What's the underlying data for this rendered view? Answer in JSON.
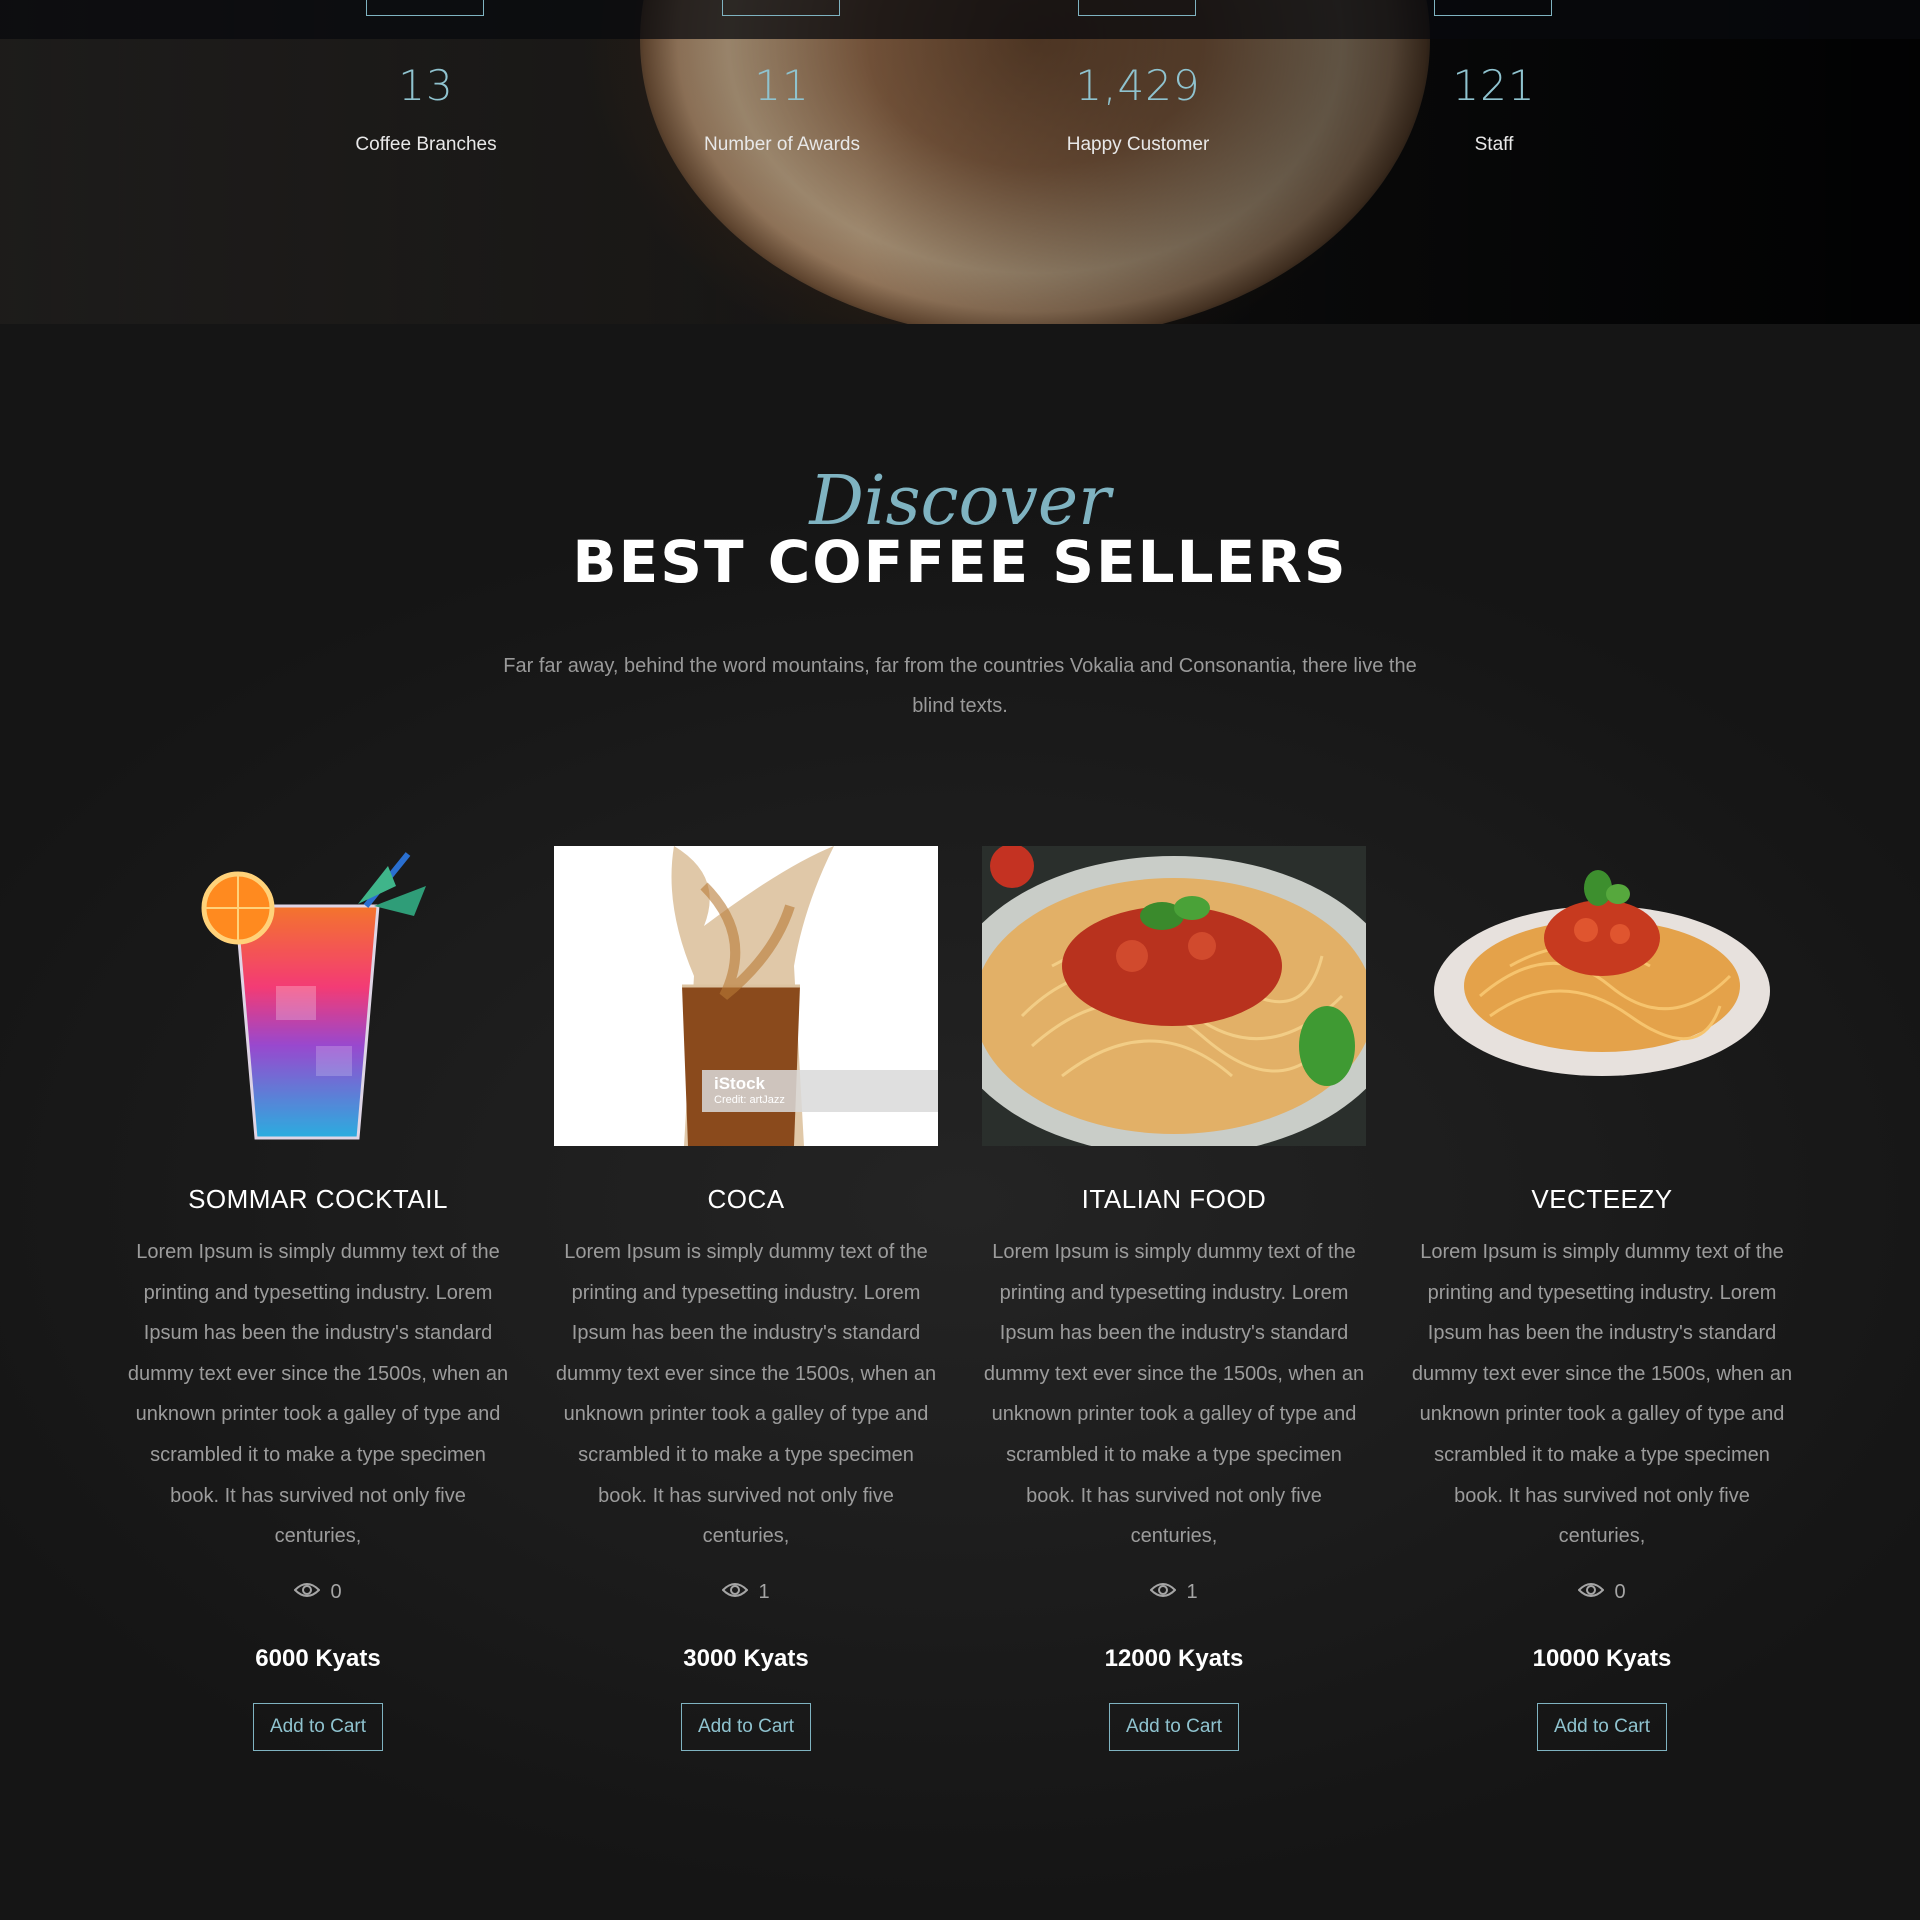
{
  "stats": [
    {
      "value": "13",
      "label": "Coffee Branches"
    },
    {
      "value": "11",
      "label": "Number of Awards"
    },
    {
      "value": "1,429",
      "label": "Happy Customer"
    },
    {
      "value": "121",
      "label": "Staff"
    }
  ],
  "section": {
    "script_title": "Discover",
    "title": "BEST COFFEE SELLERS",
    "subtitle": "Far far away, behind the word mountains, far from the countries Vokalia and Consonantia, there live the blind texts."
  },
  "products": [
    {
      "name": "SOMMAR COCKTAIL",
      "description": "Lorem Ipsum is simply dummy text of the printing and typesetting industry. Lorem Ipsum has been the industry's standard dummy text ever since the 1500s, when an unknown printer took a galley of type and scrambled it to make a type specimen book. It has survived not only five centuries,",
      "views": "0",
      "price": "6000 Kyats",
      "cart_label": "Add to Cart",
      "image_icon": "cocktail-glass-image"
    },
    {
      "name": "COCA",
      "description": "Lorem Ipsum is simply dummy text of the printing and typesetting industry. Lorem Ipsum has been the industry's standard dummy text ever since the 1500s, when an unknown printer took a galley of type and scrambled it to make a type specimen book. It has survived not only five centuries,",
      "views": "1",
      "price": "3000 Kyats",
      "cart_label": "Add to Cart",
      "image_icon": "cola-splash-image",
      "watermark": "iStock",
      "watermark_credit": "Credit: artJazz"
    },
    {
      "name": "ITALIAN FOOD",
      "description": "Lorem Ipsum is simply dummy text of the printing and typesetting industry. Lorem Ipsum has been the industry's standard dummy text ever since the 1500s, when an unknown printer took a galley of type and scrambled it to make a type specimen book. It has survived not only five centuries,",
      "views": "1",
      "price": "12000 Kyats",
      "cart_label": "Add to Cart",
      "image_icon": "spaghetti-plate-image"
    },
    {
      "name": "VECTEEZY",
      "description": "Lorem Ipsum is simply dummy text of the printing and typesetting industry. Lorem Ipsum has been the industry's standard dummy text ever since the 1500s, when an unknown printer took a galley of type and scrambled it to make a type specimen book. It has survived not only five centuries,",
      "views": "0",
      "price": "10000 Kyats",
      "cart_label": "Add to Cart",
      "image_icon": "spaghetti-dish-image"
    }
  ],
  "colors": {
    "accent": "#8fc3cf",
    "background": "#181818",
    "muted_text": "#9c9c9c"
  }
}
